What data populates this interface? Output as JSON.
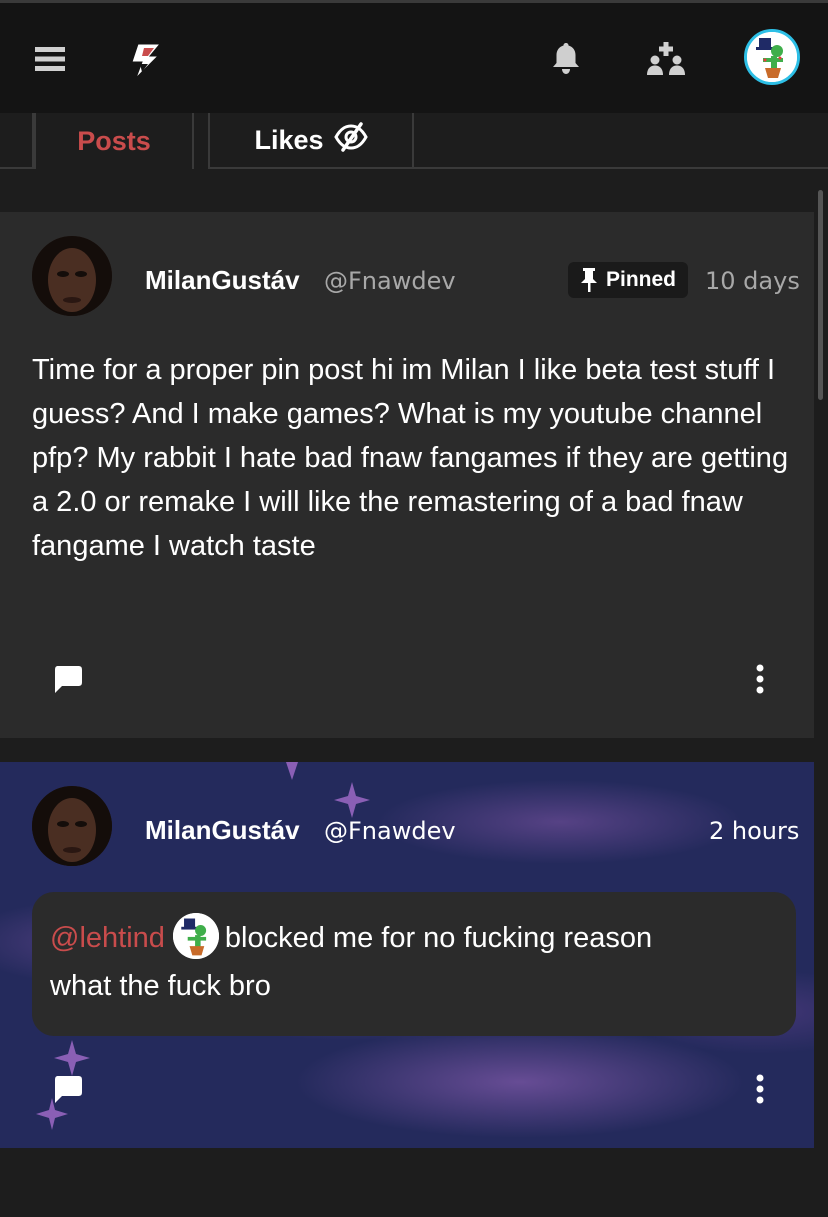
{
  "header": {
    "menu_icon": "hamburger-menu-icon",
    "logo_icon": "lightning-logo-icon",
    "notifications_icon": "bell-icon",
    "people_icon": "people-icon",
    "avatar": "user-avatar"
  },
  "tabs": [
    {
      "label": "Posts",
      "active": true,
      "color": "#c94c4c"
    },
    {
      "label": "Likes",
      "icon": "eye-slash-icon",
      "active": false
    }
  ],
  "posts": [
    {
      "display_name": "MilanGustáv",
      "handle": "@Fnawdev",
      "pinned_label": "Pinned",
      "time": "10 days",
      "text": "Time for a proper pin post hi im Milan I like beta test stuff I guess? And I make games? What is my youtube channel pfp? My rabbit I hate bad fnaw fangames if they are getting a 2.0 or remake I will like the remastering of a bad fnaw fangame I watch taste"
    },
    {
      "display_name": "MilanGustáv",
      "handle": "@Fnawdev",
      "time": "2 hours",
      "mention": "@lehtind",
      "text_line1": "blocked me for no fucking reason",
      "text_line2": "what the fuck bro"
    }
  ],
  "colors": {
    "accent": "#c94c4c",
    "background": "#1d1d1d",
    "card": "#2b2b2b",
    "topbar": "#141414",
    "avatar_ring": "#2dbfe6"
  }
}
